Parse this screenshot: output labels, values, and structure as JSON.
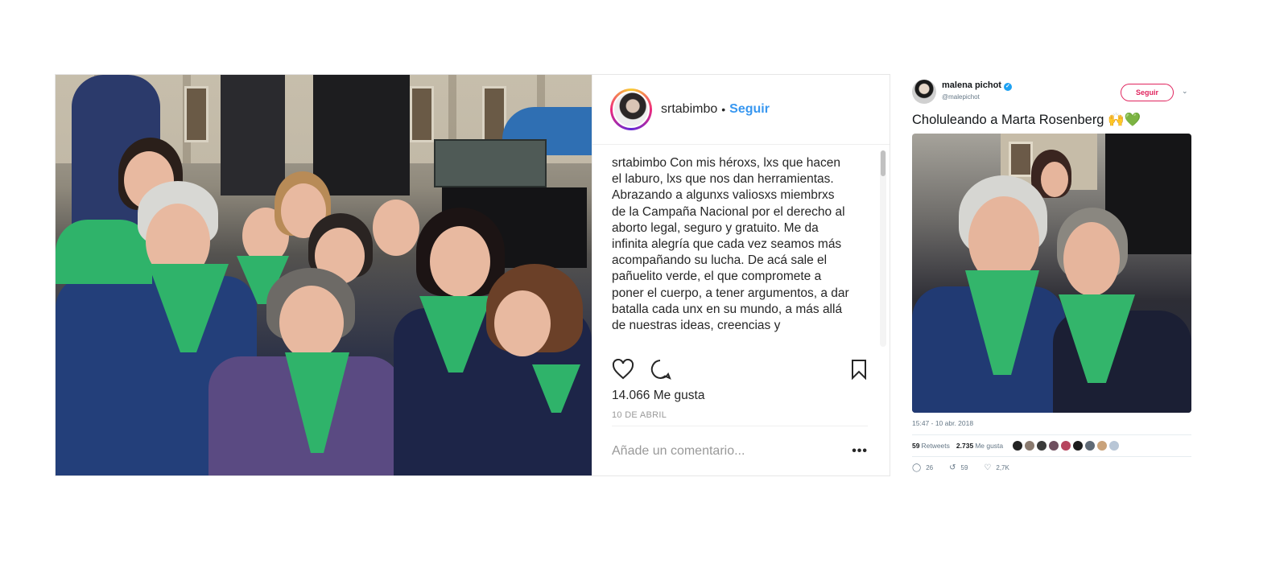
{
  "instagram": {
    "username": "srtabimbo",
    "separator": "•",
    "follow_label": "Seguir",
    "caption_user": "srtabimbo",
    "caption_text": "Con mis héroxs, lxs que hacen el laburo, lxs que nos dan herramientas. Abrazando a algunxs valiosxs miembrxs de la Campaña Nacional por el derecho al aborto legal, seguro y gratuito. Me da infinita alegría que cada vez seamos más acompañando su lucha. De acá sale el pañuelito verde, el que compromete a poner el cuerpo, a tener argumentos, a dar batalla cada unx en su mundo, a más allá de nuestras ideas, creencias y",
    "likes": "14.066 Me gusta",
    "date": "10 DE ABRIL",
    "comment_placeholder": "Añade un comentario...",
    "more_label": "•••",
    "icons": [
      "heart-icon",
      "comment-icon",
      "bookmark-icon",
      "more-icon"
    ]
  },
  "tweet": {
    "name": "malena pichot",
    "verified_mark": "✓",
    "handle": "@malepichot",
    "follow_label": "Seguir",
    "chevron": "⌄",
    "text": "Choluleando a Marta Rosenberg 🙌💚",
    "timestamp": "15:47 - 10 abr. 2018",
    "retweets_count": "59",
    "retweets_label": "Retweets",
    "likes_count": "2.735",
    "likes_label": "Me gusta",
    "reply_count": "26",
    "retweet_count": "59",
    "like_count": "2,7K",
    "icons": [
      "reply-icon",
      "retweet-icon",
      "like-icon"
    ],
    "accent_color": "#e0245e"
  },
  "colors": {
    "instagram_link": "#3897f0",
    "scarf_green": "#2fb36a",
    "twitter_blue": "#1da1f2"
  }
}
